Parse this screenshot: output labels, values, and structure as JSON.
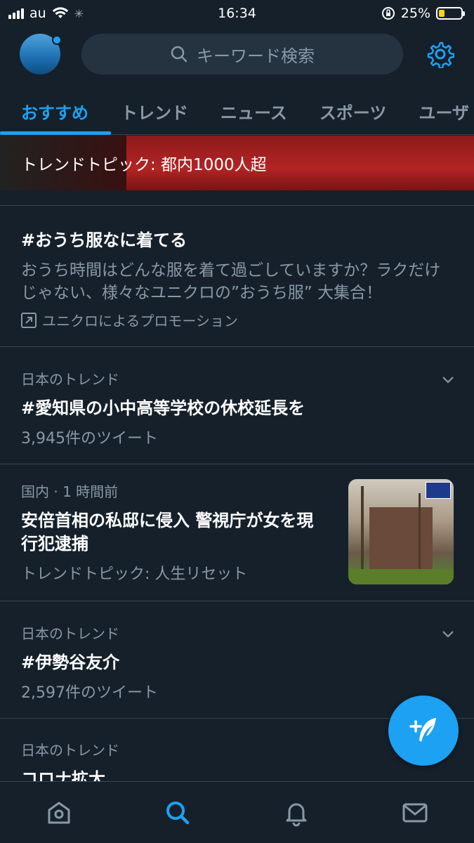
{
  "status_bar": {
    "carrier": "au",
    "time": "16:34",
    "battery_percent": "25%",
    "battery_level": 0.25
  },
  "header": {
    "search_placeholder": "キーワード検索",
    "settings_icon": "gear-icon"
  },
  "tabs": [
    {
      "label": "おすすめ",
      "active": true
    },
    {
      "label": "トレンド",
      "active": false
    },
    {
      "label": "ニュース",
      "active": false
    },
    {
      "label": "スポーツ",
      "active": false
    },
    {
      "label": "ユーザ",
      "active": false
    }
  ],
  "hero": {
    "caption": "トレンドトピック: 都内1000人超"
  },
  "promo": {
    "title": "#おうち服なに着てる",
    "description": "おうち時間はどんな服を着て過ごしていますか？ラクだけじゃない、様々なユニクロの”おうち服” 大集合！",
    "promoted_by": "ユニクロによるプロモーション"
  },
  "trends": [
    {
      "context": "日本のトレンド",
      "title": "#愛知県の小中高等学校の休校延長を",
      "count": "3,945件のツイート"
    },
    {
      "context": "国内 · 1 時間前",
      "title": "安倍首相の私邸に侵入 警視庁が女を現行犯逮捕",
      "count": "トレンドトピック: 人生リセット"
    },
    {
      "context": "日本のトレンド",
      "title": "#伊勢谷友介",
      "count": "2,597件のツイート"
    },
    {
      "context": "日本のトレンド",
      "title": "コロナ拡大"
    }
  ],
  "colors": {
    "background": "#15202b",
    "accent": "#1da1f2",
    "muted": "#8899a6",
    "divider": "#38444d"
  },
  "nav": [
    {
      "icon": "home-icon",
      "active": false
    },
    {
      "icon": "search-icon",
      "active": true
    },
    {
      "icon": "bell-icon",
      "active": false
    },
    {
      "icon": "mail-icon",
      "active": false
    }
  ]
}
